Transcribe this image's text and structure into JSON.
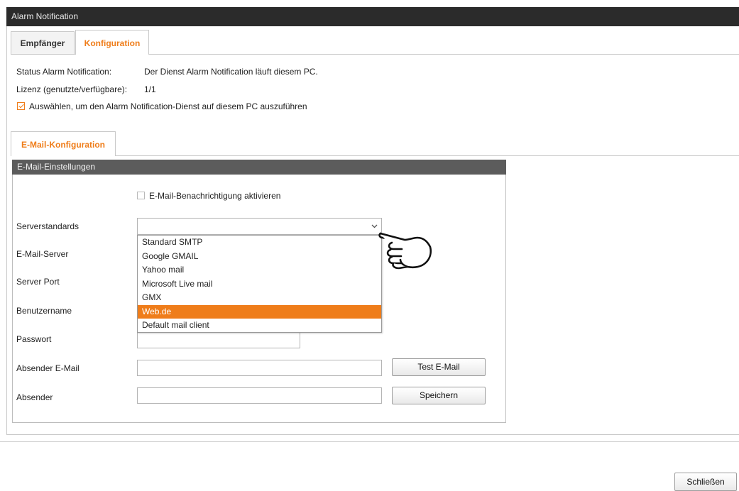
{
  "window": {
    "title": "Alarm Notification"
  },
  "tabs": [
    {
      "label": "Empfänger",
      "active": false
    },
    {
      "label": "Konfiguration",
      "active": true
    }
  ],
  "status": {
    "label": "Status Alarm Notification:",
    "value": "Der Dienst Alarm Notification läuft diesem PC.",
    "license_label": "Lizenz (genutzte/verfügbare):",
    "license_value": "1/1",
    "run_service_label": "Auswählen, um den Alarm Notification-Dienst auf diesem PC auszuführen",
    "run_service_checked": true
  },
  "subtab": {
    "label": "E-Mail-Konfiguration"
  },
  "email_settings": {
    "header": "E-Mail-Einstellungen",
    "enable_label": "E-Mail-Benachrichtigung aktivieren",
    "enable_checked": false,
    "labels": {
      "server_defaults": "Serverstandards",
      "email_server": "E-Mail-Server",
      "server_port": "Server Port",
      "username": "Benutzername",
      "password": "Passwort",
      "sender_email": "Absender E-Mail",
      "sender": "Absender"
    },
    "server_defaults_value": "",
    "server_options": [
      "Standard SMTP",
      "Google GMAIL",
      "Yahoo mail",
      "Microsoft Live mail",
      "GMX",
      "Web.de",
      "Default mail client"
    ],
    "highlighted_option": "Web.de",
    "buttons": {
      "test": "Test E-Mail",
      "save": "Speichern"
    }
  },
  "footer": {
    "close": "Schließen"
  },
  "colors": {
    "accent": "#ef7d1a",
    "titlebar": "#2b2b2b",
    "panel_header": "#5c5c5c"
  },
  "icons": {
    "pointer": "pointing-hand-icon",
    "dropdown": "chevron-down-icon"
  }
}
